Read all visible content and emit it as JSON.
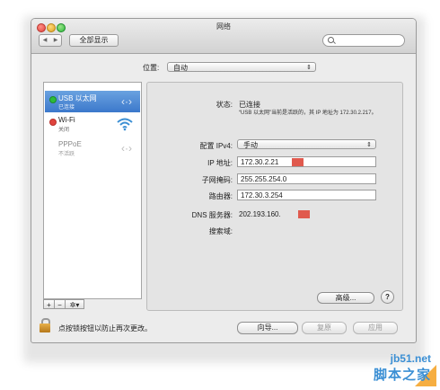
{
  "window": {
    "title": "网络",
    "nav_back": "◀",
    "nav_forward": "▶",
    "show_all": "全部显示",
    "search_placeholder": ""
  },
  "location": {
    "label": "位置:",
    "value": "自动"
  },
  "services": [
    {
      "name": "USB 以太网",
      "status": "已连接",
      "status_color": "#2dbc3b",
      "selected": true,
      "icon": "ethernet-arrows-icon"
    },
    {
      "name": "Wi-Fi",
      "status": "关闭",
      "status_color": "#e0443e",
      "selected": false,
      "icon": "wifi-icon"
    },
    {
      "name": "PPPoE",
      "status": "不活跃",
      "status_color": "",
      "selected": false,
      "icon": "ethernet-arrows-icon"
    }
  ],
  "sidebar_buttons": {
    "add": "+",
    "remove": "−",
    "gear": "✲▾"
  },
  "detail": {
    "status_label": "状态:",
    "status_value": "已连接",
    "status_note": "“USB 以太网”当前是活跃的，其 IP 地址为 172.30.2.217。",
    "config_label": "配置 IPv4:",
    "config_value": "手动",
    "ip_label": "IP 地址:",
    "ip_value": "172.30.2.21",
    "mask_label": "子网掩码:",
    "mask_value": "255.255.254.0",
    "router_label": "路由器:",
    "router_value": "172.30.3.254",
    "dns_label": "DNS 服务器:",
    "dns_value": "202.193.160.",
    "search_domain_label": "搜索域:",
    "advanced_button": "高级...",
    "help_button": "?"
  },
  "footer": {
    "lock_text": "点按锁按钮以防止再次更改。",
    "assistant_button": "向导...",
    "revert_button": "复原",
    "apply_button": "应用"
  },
  "watermark": {
    "url": "jb51.net",
    "name": "脚本之家"
  },
  "colors": {
    "selection": "#3b78cb",
    "redaction": "#e05a4e",
    "watermark": "#3b8fd4"
  }
}
